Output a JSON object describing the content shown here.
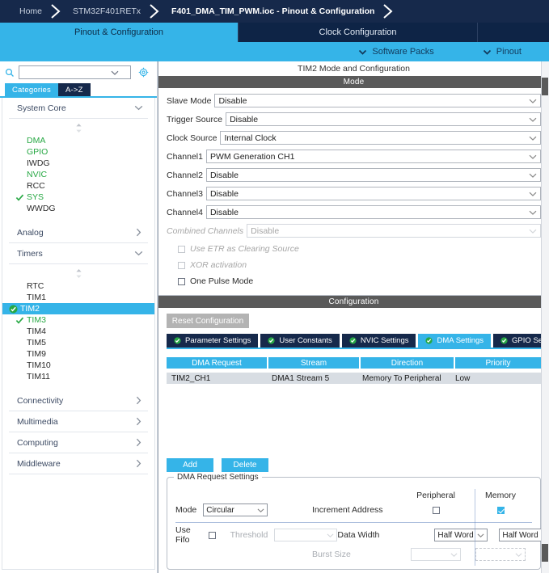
{
  "breadcrumb": {
    "items": [
      {
        "label": "Home",
        "active": false
      },
      {
        "label": "STM32F401RETx",
        "active": false
      },
      {
        "label": "F401_DMA_TIM_PWM.ioc - Pinout & Configuration",
        "active": true
      }
    ]
  },
  "top_tabs": [
    {
      "label": "Pinout & Configuration",
      "selected": true
    },
    {
      "label": "Clock Configuration",
      "selected": false
    },
    {
      "label": "",
      "selected": false
    }
  ],
  "sub_bar": {
    "items": [
      {
        "label": "Software Packs",
        "icon": "chevron-down-icon"
      },
      {
        "label": "Pinout",
        "icon": "chevron-down-icon"
      }
    ]
  },
  "sidebar": {
    "search": {
      "value": "",
      "placeholder": "",
      "icon": "search-icon"
    },
    "gear_icon": "gear-icon",
    "view_tabs": [
      {
        "label": "Categories",
        "selected": true
      },
      {
        "label": "A->Z",
        "selected": false
      }
    ],
    "groups": [
      {
        "title": "System Core",
        "expanded": true,
        "items": [
          {
            "label": "DMA",
            "state": "green"
          },
          {
            "label": "GPIO",
            "state": "green"
          },
          {
            "label": "IWDG",
            "state": "normal"
          },
          {
            "label": "NVIC",
            "state": "green"
          },
          {
            "label": "RCC",
            "state": "normal"
          },
          {
            "label": "SYS",
            "state": "green",
            "mark": "check"
          },
          {
            "label": "WWDG",
            "state": "normal"
          }
        ]
      },
      {
        "title": "Analog",
        "expanded": false,
        "items": []
      },
      {
        "title": "Timers",
        "expanded": true,
        "items": [
          {
            "label": "RTC",
            "state": "normal"
          },
          {
            "label": "TIM1",
            "state": "normal"
          },
          {
            "label": "TIM2",
            "state": "selected",
            "mark": "check-badge"
          },
          {
            "label": "TIM3",
            "state": "green",
            "mark": "check"
          },
          {
            "label": "TIM4",
            "state": "normal"
          },
          {
            "label": "TIM5",
            "state": "normal"
          },
          {
            "label": "TIM9",
            "state": "normal"
          },
          {
            "label": "TIM10",
            "state": "normal"
          },
          {
            "label": "TIM11",
            "state": "normal"
          }
        ]
      },
      {
        "title": "Connectivity",
        "expanded": false,
        "items": []
      },
      {
        "title": "Multimedia",
        "expanded": false,
        "items": []
      },
      {
        "title": "Computing",
        "expanded": false,
        "items": []
      },
      {
        "title": "Middleware",
        "expanded": false,
        "items": []
      }
    ]
  },
  "main": {
    "pane_title": "TIM2 Mode and Configuration",
    "mode_band": "Mode",
    "mode_fields": [
      {
        "label": "Slave Mode",
        "value": "Disable",
        "disabled": false
      },
      {
        "label": "Trigger Source",
        "value": "Disable",
        "disabled": false
      },
      {
        "label": "Clock Source",
        "value": "Internal Clock",
        "disabled": false
      },
      {
        "label": "Channel1",
        "value": "PWM Generation CH1",
        "disabled": false
      },
      {
        "label": "Channel2",
        "value": "Disable",
        "disabled": false
      },
      {
        "label": "Channel3",
        "value": "Disable",
        "disabled": false
      },
      {
        "label": "Channel4",
        "value": "Disable",
        "disabled": false
      },
      {
        "label": "Combined Channels",
        "value": "Disable",
        "disabled": true
      }
    ],
    "mode_checks": [
      {
        "label": "Use ETR as Clearing Source",
        "checked": false,
        "disabled": true
      },
      {
        "label": "XOR activation",
        "checked": false,
        "disabled": true
      },
      {
        "label": "One Pulse Mode",
        "checked": false,
        "disabled": false
      }
    ],
    "config_band": "Configuration",
    "reset_button": "Reset Configuration",
    "config_tabs": [
      {
        "label": "Parameter Settings",
        "selected": false,
        "icon": "check-circle-icon"
      },
      {
        "label": "User Constants",
        "selected": false,
        "icon": "check-circle-icon"
      },
      {
        "label": "NVIC Settings",
        "selected": false,
        "icon": "check-circle-icon"
      },
      {
        "label": "DMA Settings",
        "selected": true,
        "icon": "check-circle-icon"
      },
      {
        "label": "GPIO Settings",
        "selected": false,
        "icon": "check-circle-icon"
      }
    ],
    "dma_table": {
      "headers": [
        "DMA Request",
        "Stream",
        "Direction",
        "Priority"
      ],
      "rows": [
        [
          "TIM2_CH1",
          "DMA1 Stream 5",
          "Memory To Peripheral",
          "Low"
        ]
      ]
    },
    "buttons": {
      "add": "Add",
      "delete": "Delete"
    },
    "request_settings": {
      "legend": "DMA Request Settings",
      "col_peripheral": "Peripheral",
      "col_memory": "Memory",
      "mode_label": "Mode",
      "mode_value": "Circular",
      "increment_label": "Increment Address",
      "increment_peripheral": false,
      "increment_memory": true,
      "use_fifo_label": "Use Fifo",
      "use_fifo_checked": false,
      "threshold_label": "Threshold",
      "threshold_value": "",
      "threshold_disabled": true,
      "data_width_label": "Data Width",
      "data_width_peripheral": "Half Word",
      "data_width_memory": "Half Word",
      "burst_size_label": "Burst Size",
      "burst_size_peripheral": "",
      "burst_size_memory": "",
      "burst_disabled": true
    }
  },
  "colors": {
    "navy": "#16294b",
    "accent_blue": "#35b4e8",
    "green": "#27a844",
    "band_gray": "#5a5a5a",
    "row_gray": "#d8dde3"
  }
}
